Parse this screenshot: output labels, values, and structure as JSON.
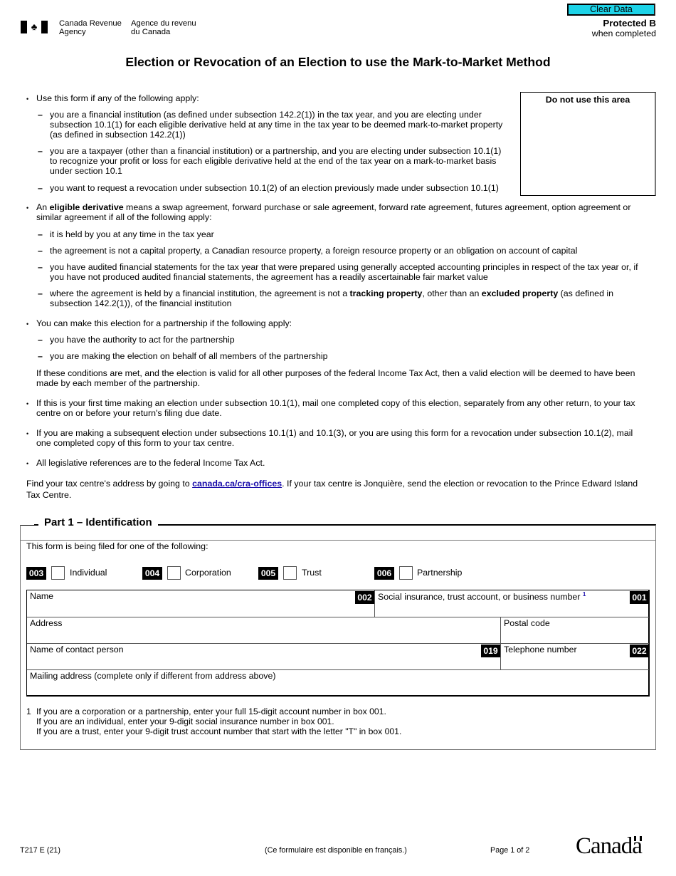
{
  "header": {
    "agency_en_line1": "Canada Revenue",
    "agency_en_line2": "Agency",
    "agency_fr_line1": "Agence du revenu",
    "agency_fr_line2": "du Canada",
    "flag_icon": "maple-leaf-flag",
    "clear_button": "Clear Data",
    "clear_button_color": "#1dd3e8",
    "protected": "Protected B",
    "protected_sub": "when completed"
  },
  "title": "Election or Revocation of an Election to use the Mark-to-Market Method",
  "do_not_use": "Do not use this area",
  "instructions": {
    "use_form": "Use this form if any of the following apply:",
    "use_items": [
      [
        "you are a financial institution (as defined under subsection 142.2(1)) in the tax year, and you are electing under",
        "subsection 10.1(1) for each eligible derivative held at any time in the tax year to be deemed mark-to-market property",
        "(as defined in subsection 142.2(1))"
      ],
      [
        "you are a taxpayer (other than a financial institution) or a partnership, and you are electing under subsection 10.1(1)",
        "to recognize your profit or loss for each eligible derivative held at the end of the tax year on a mark-to-market basis",
        "under section 10.1"
      ],
      [
        "you want to request a revocation under subsection 10.1(2) of an election previously made under subsection 10.1(1)"
      ]
    ],
    "eligible": {
      "prefix": "An ",
      "bold": "eligible derivative",
      "rest": " means a swap agreement, forward purchase or sale agreement, forward rate agreement, futures agreement, option agreement or",
      "line2": "similar agreement if all of the following apply:"
    },
    "eligible_items": [
      [
        "it is held by you at any time in the tax year"
      ],
      [
        "the agreement is not a capital property, a Canadian resource property, a foreign resource property or an obligation on account of capital"
      ],
      [
        "you have audited financial statements for the tax year that were prepared using generally accepted accounting principles in respect of the tax year or, if",
        "you have not produced audited financial statements, the agreement has a readily ascertainable fair market value"
      ]
    ],
    "tracking": {
      "a": "where the agreement is held by a financial institution, the agreement is not a ",
      "b": "tracking property",
      "c": ", other than an ",
      "d": "excluded property",
      "e": " (as defined in",
      "line2": "subsection 142.2(1)), of the financial institution"
    },
    "partnership": "You can make this election for a partnership if the following apply:",
    "partnership_items": [
      "you have the authority to act for the partnership",
      "you are making the election on behalf of all members of the partnership"
    ],
    "partnership_note": [
      "If these conditions are met, and the election is valid for all other purposes of the federal Income Tax Act, then a valid election will be deemed to have been",
      "made by each member of the partnership."
    ],
    "first_time": [
      "If this is your first time making an election under subsection 10.1(1), mail one completed copy of this election, separately from any other return, to your tax",
      "centre on or before your return's filing due date."
    ],
    "subsequent": [
      "If you are making a subsequent election under subsections 10.1(1) and 10.1(3), or you are using this form for a revocation under subsection 10.1(2), mail",
      "one completed copy of this form to your tax centre."
    ],
    "legislative": "All legislative references are to the federal Income Tax Act.",
    "find": {
      "a": "Find your tax centre's address by going to ",
      "link": "canada.ca/cra-offices",
      "b": ". If your tax centre is Jonquière, send the election or revocation to the Prince Edward Island",
      "line2": "Tax Centre."
    }
  },
  "part1": {
    "title": "Part 1 – Identification",
    "filed_for": "This form is being filed for one of the following:",
    "options": [
      {
        "code": "003",
        "label": "Individual",
        "checked": false
      },
      {
        "code": "004",
        "label": "Corporation",
        "checked": false
      },
      {
        "code": "005",
        "label": "Trust",
        "checked": false
      },
      {
        "code": "006",
        "label": "Partnership",
        "checked": false
      }
    ],
    "fields": {
      "name": {
        "label": "Name",
        "code": "002",
        "value": ""
      },
      "sin": {
        "label": "Social insurance, trust account, or business number",
        "footnote": "1",
        "code": "001",
        "value": ""
      },
      "address": {
        "label": "Address",
        "value": ""
      },
      "postal": {
        "label": "Postal code",
        "value": ""
      },
      "contact": {
        "label": "Name of contact person",
        "code": "019",
        "value": ""
      },
      "phone": {
        "label": "Telephone number",
        "code": "022",
        "value": ""
      },
      "mailing": {
        "label": "Mailing address (complete only if different from address above)",
        "value": ""
      }
    },
    "footnote_num": "1",
    "footnote_lines": [
      "If you are a corporation or a partnership, enter your full 15-digit account number in box 001.",
      "If you are an individual, enter your 9-digit social insurance number in box 001.",
      "If you are a trust, enter your 9-digit trust account number that start with the letter \"T\" in box 001."
    ]
  },
  "footer": {
    "form_code": "T217 E (21)",
    "french": "(Ce formulaire est disponible en français.)",
    "page": "Page 1 of 2",
    "wordmark": "Canada"
  }
}
